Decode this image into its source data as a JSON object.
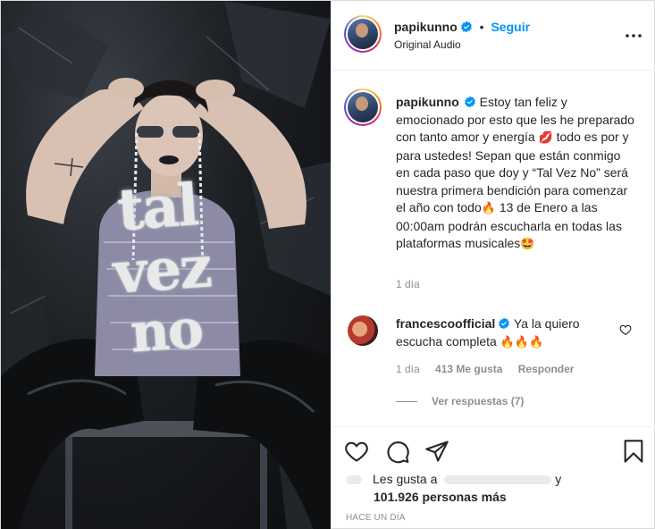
{
  "post": {
    "media": {
      "title_words": [
        "tal",
        "vez",
        "no"
      ]
    },
    "header": {
      "username": "papikunno",
      "separator": "•",
      "follow_label": "Seguir",
      "audio_label": "Original Audio"
    },
    "caption": {
      "username": "papikunno",
      "text_1": "Estoy tan feliz y emocionado por esto que les he preparado con tanto amor y energía",
      "emoji_lips": "💋",
      "text_2": "todo es por y para ustedes! Sepan que están conmigo en cada paso que doy y “Tal Vez No” será nuestra primera bendición para comenzar el año con todo",
      "emoji_fire": "🔥",
      "text_3": "13 de Enero a las 00:00am podrán escucharla en todas las plataformas musicales",
      "emoji_star_eyes": "🤩",
      "time": "1 día"
    },
    "comment": {
      "username": "francescoofficial",
      "text": "Ya la quiero escucha completa",
      "emojis": "🔥🔥🔥",
      "time": "1 día",
      "likes": "413 Me gusta",
      "reply_label": "Responder",
      "view_replies": "Ver respuestas (7)"
    },
    "actions": {
      "likes_prefix": "Les gusta a",
      "likes_and": "y",
      "likes_count": "101.926",
      "likes_suffix": "personas más",
      "time_ago": "HACE UN DÍA"
    }
  },
  "colors": {
    "link": "#0095f6",
    "text": "#262626",
    "muted": "#8e8e8e",
    "verified": "#0095f6"
  },
  "icons": [
    "verified-badge-icon",
    "more-options-icon",
    "heart-icon",
    "comment-icon",
    "share-icon",
    "bookmark-icon"
  ]
}
